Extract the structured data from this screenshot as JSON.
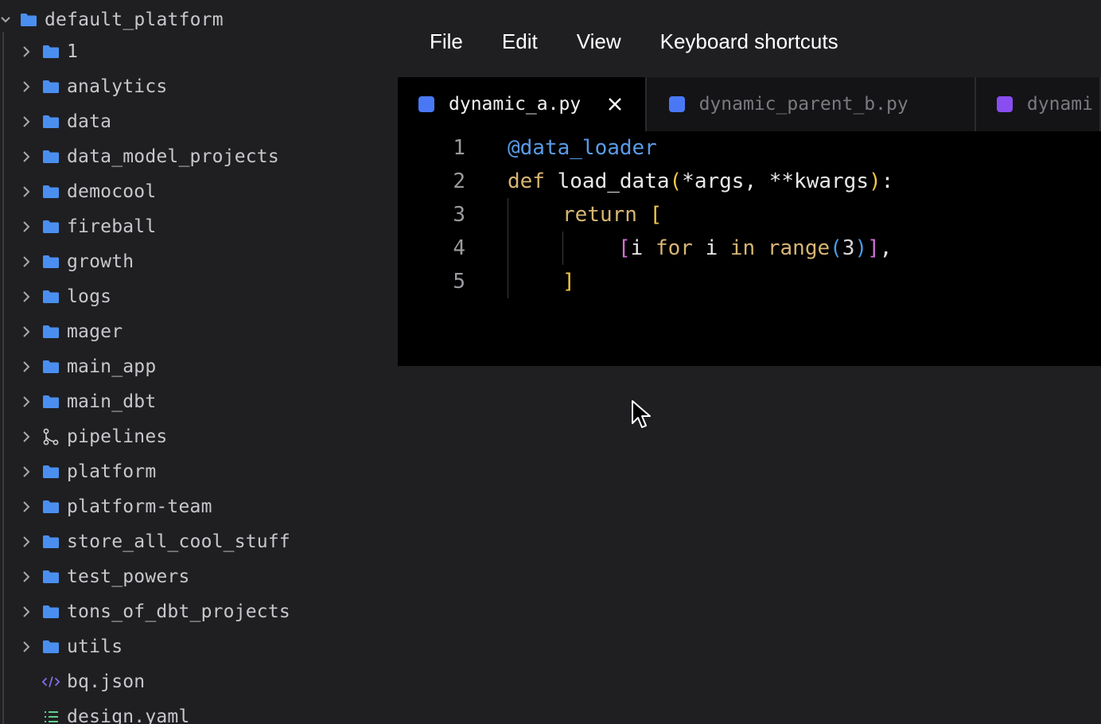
{
  "tree": {
    "root": "default_platform",
    "items": [
      {
        "label": "1",
        "icon": "folder-icon"
      },
      {
        "label": "analytics",
        "icon": "folder-icon"
      },
      {
        "label": "data",
        "icon": "folder-icon"
      },
      {
        "label": "data_model_projects",
        "icon": "folder-icon"
      },
      {
        "label": "democool",
        "icon": "folder-icon"
      },
      {
        "label": "fireball",
        "icon": "folder-icon"
      },
      {
        "label": "growth",
        "icon": "folder-icon"
      },
      {
        "label": "logs",
        "icon": "folder-icon"
      },
      {
        "label": "mager",
        "icon": "folder-icon"
      },
      {
        "label": "main_app",
        "icon": "folder-icon"
      },
      {
        "label": "main_dbt",
        "icon": "folder-icon"
      },
      {
        "label": "pipelines",
        "icon": "pipeline-icon"
      },
      {
        "label": "platform",
        "icon": "folder-icon"
      },
      {
        "label": "platform-team",
        "icon": "folder-icon"
      },
      {
        "label": "store_all_cool_stuff",
        "icon": "folder-icon"
      },
      {
        "label": "test_powers",
        "icon": "folder-icon"
      },
      {
        "label": "tons_of_dbt_projects",
        "icon": "folder-icon"
      },
      {
        "label": "utils",
        "icon": "folder-icon"
      },
      {
        "label": "bq.json",
        "icon": "code-file-icon"
      },
      {
        "label": "design.yaml",
        "icon": "list-file-icon"
      }
    ]
  },
  "menu": {
    "file": "File",
    "edit": "Edit",
    "view": "View",
    "shortcuts": "Keyboard shortcuts"
  },
  "tabs": [
    {
      "label": "dynamic_a.py",
      "color": "#4a78f5",
      "active": true
    },
    {
      "label": "dynamic_parent_b.py",
      "color": "#4a78f5",
      "active": false
    },
    {
      "label": "dynami",
      "color": "#8a4df0",
      "active": false
    }
  ],
  "code": {
    "line_numbers": [
      "1",
      "2",
      "3",
      "4",
      "5"
    ],
    "l1": {
      "decorator": "@data_loader"
    },
    "l2": {
      "kw": "def",
      "name": " load_data",
      "open": "(",
      "args": "*args, **kwargs",
      "close": ")",
      "colon": ":"
    },
    "l3": {
      "kw": "return",
      "open": " ["
    },
    "l4": {
      "open": "[",
      "i1": "i ",
      "for": "for",
      "i2": " i ",
      "in": "in",
      "range": " range",
      "popen": "(",
      "num": "3",
      "pclose": ")",
      "close": "]",
      "comma": ","
    },
    "l5": {
      "close": "]"
    }
  },
  "colors": {
    "folder": "#4a8ff0",
    "background": "#1f1f22",
    "editor": "#000000"
  }
}
